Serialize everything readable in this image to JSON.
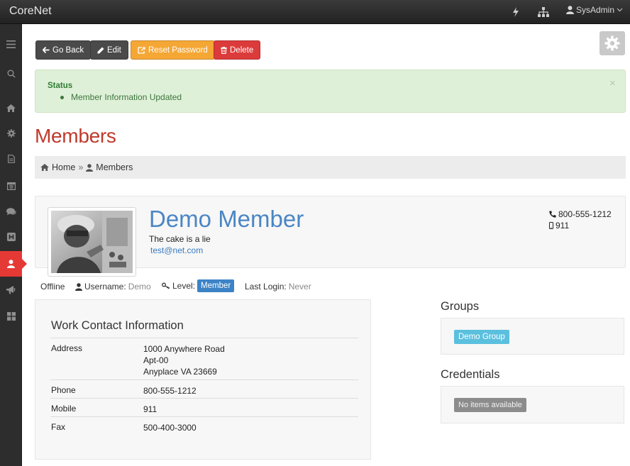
{
  "app": {
    "title": "CoreNet"
  },
  "topbar": {
    "user_label": "SysAdmin",
    "icons": [
      "bolt-icon",
      "sitemap-icon",
      "user-icon",
      "chevron-down-icon"
    ]
  },
  "sidebar": {
    "items": [
      {
        "icon": "menu-icon"
      },
      {
        "icon": "search-icon"
      },
      {
        "icon": "home-icon"
      },
      {
        "icon": "settings-icon"
      },
      {
        "icon": "document-icon"
      },
      {
        "icon": "calendar-icon"
      },
      {
        "icon": "chat-icon"
      },
      {
        "icon": "h-square-icon"
      },
      {
        "icon": "user-icon",
        "active": true
      },
      {
        "icon": "bullhorn-icon"
      },
      {
        "icon": "grid-icon"
      }
    ]
  },
  "toolbar": {
    "go_back": "Go Back",
    "edit": "Edit",
    "reset_password": "Reset Password",
    "delete": "Delete"
  },
  "alert": {
    "title": "Status",
    "message": "Member Information Updated",
    "close": "×"
  },
  "page": {
    "title": "Members"
  },
  "breadcrumb": {
    "home": "Home",
    "separator": "»",
    "current": "Members"
  },
  "member": {
    "name": "Demo Member",
    "tagline": "The cake is a lie",
    "email": "test@net.com",
    "phone": "800-555-1212",
    "mobile": "911",
    "status": "Offline",
    "username_label": "Username:",
    "username": "Demo",
    "level_label": "Level:",
    "level": "Member",
    "last_login_label": "Last Login:",
    "last_login": "Never"
  },
  "work_contact": {
    "title": "Work Contact Information",
    "rows": [
      {
        "label": "Address",
        "lines": [
          "1000 Anywhere Road",
          "Apt-00",
          "Anyplace VA 23669"
        ]
      },
      {
        "label": "Phone",
        "value": "800-555-1212"
      },
      {
        "label": "Mobile",
        "value": "911"
      },
      {
        "label": "Fax",
        "value": "500-400-3000"
      }
    ]
  },
  "groups": {
    "title": "Groups",
    "items": [
      "Demo Group"
    ]
  },
  "credentials": {
    "title": "Credentials",
    "empty_label": "No items available"
  },
  "colors": {
    "accent_red": "#c0392b",
    "active_sidebar": "#e53935",
    "link_blue": "#4a86c4",
    "alert_bg": "#dff0d8",
    "warning": "#f5a735",
    "danger": "#dc3b3b",
    "info": "#5bc0de",
    "primary": "#3c83c6"
  }
}
